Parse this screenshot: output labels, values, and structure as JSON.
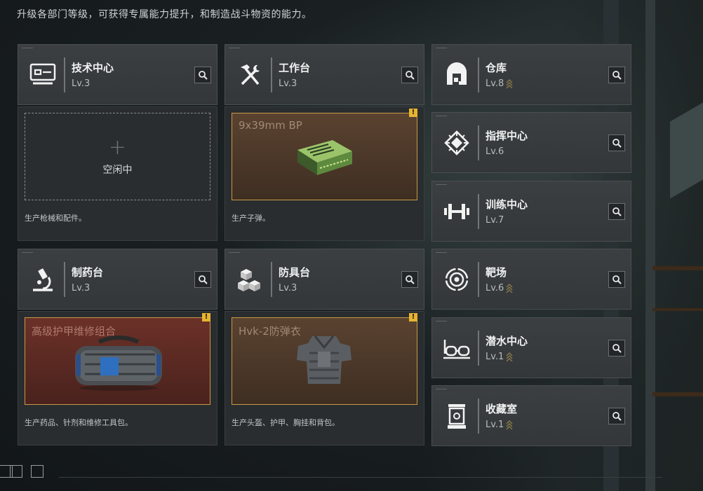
{
  "headline": "升级各部门等级，可获得专属能力提升，和制造战斗物资的能力。",
  "departments": {
    "tech": {
      "name": "技术中心",
      "level": "Lv.3",
      "icon": "monitor-chip-icon"
    },
    "workbench": {
      "name": "工作台",
      "level": "Lv.3",
      "icon": "hammer-wrench-icon"
    },
    "pharmacy": {
      "name": "制药台",
      "level": "Lv.3",
      "icon": "microscope-icon"
    },
    "armory": {
      "name": "防具台",
      "level": "Lv.3",
      "icon": "cubes-icon"
    },
    "warehouse": {
      "name": "仓库",
      "level": "Lv.8",
      "icon": "warehouse-icon",
      "upgrade": true
    },
    "command": {
      "name": "指挥中心",
      "level": "Lv.6",
      "icon": "command-emblem-icon"
    },
    "training": {
      "name": "训练中心",
      "level": "Lv.7",
      "icon": "dumbbell-icon"
    },
    "range": {
      "name": "靶场",
      "level": "Lv.6",
      "icon": "target-icon",
      "upgrade": true
    },
    "diving": {
      "name": "潜水中心",
      "level": "Lv.1",
      "icon": "diving-goggles-icon",
      "upgrade": true
    },
    "collection": {
      "name": "收藏室",
      "level": "Lv.1",
      "icon": "display-case-icon",
      "upgrade": true
    }
  },
  "production": {
    "tech": {
      "idle_label": "空闲中",
      "desc": "生产枪械和配件。"
    },
    "workbench": {
      "item": "9x39mm BP",
      "desc": "生产子弹。",
      "alert": "!"
    },
    "pharmacy": {
      "item": "高级护甲维修组合",
      "desc": "生产药品、针剂和维修工具包。",
      "alert": "!"
    },
    "armory": {
      "item": "Hvk-2防弹衣",
      "desc": "生产头盔、护甲、胸挂和背包。",
      "alert": "!"
    }
  },
  "colors": {
    "accent_gold": "#c79a45",
    "alert_yellow": "#e6b431",
    "upgrade_chevron": "#8a7a4a"
  }
}
